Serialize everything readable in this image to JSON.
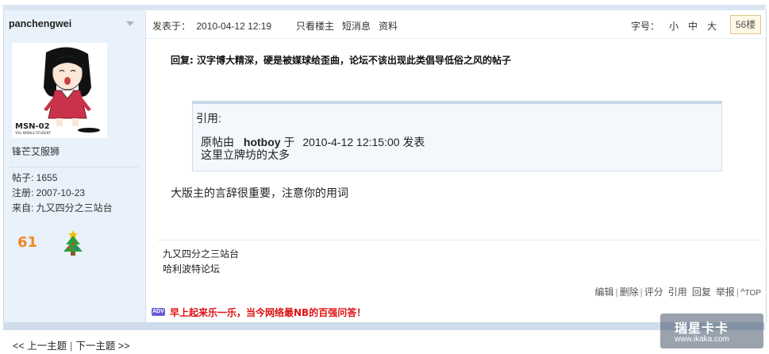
{
  "sidebar": {
    "username": "panchengwei",
    "user_title": "锋芒艾服狮",
    "posts_label": "帖子: 1655",
    "register_label": "注册: 2007-10-23",
    "from_label": "来自: 九又四分之三站台",
    "medal_text": "61"
  },
  "post_header": {
    "posted_label": "发表于：",
    "posted_time": "2010-04-12 12:19",
    "only_author": "只看楼主",
    "short_msg": "短消息",
    "profile": "资料",
    "font_label": "字号：",
    "font_small": "小",
    "font_medium": "中",
    "font_large": "大",
    "floor": "56楼"
  },
  "post": {
    "title": "回复: 汉字博大精深，硬是被媒球给歪曲，论坛不该出现此类倡导低俗之风的帖子",
    "quote_header": "引用:",
    "quote_prefix": "原帖由",
    "quote_author": "hotboy",
    "quote_mid": "于",
    "quote_time": "2010-4-12 12:15:00",
    "quote_suffix": "发表",
    "quote_text": "这里立牌坊的太多",
    "reply_text": "大版主的言辞很重要，注意你的用词",
    "signature": [
      "九又四分之三站台",
      "哈利波特论坛"
    ]
  },
  "actions": [
    "编辑",
    "删除",
    "评分",
    "引用",
    "回复",
    "举报",
    "TOP"
  ],
  "ad": {
    "badge": "ADV",
    "text": "早上起来乐一乐，当今网络最NB的百强问答！"
  },
  "nav": {
    "prev": "<< 上一主题",
    "next": "下一主题 >>"
  },
  "watermark": {
    "line1": "瑞星卡卡",
    "line2": "www.ikaka.com"
  }
}
